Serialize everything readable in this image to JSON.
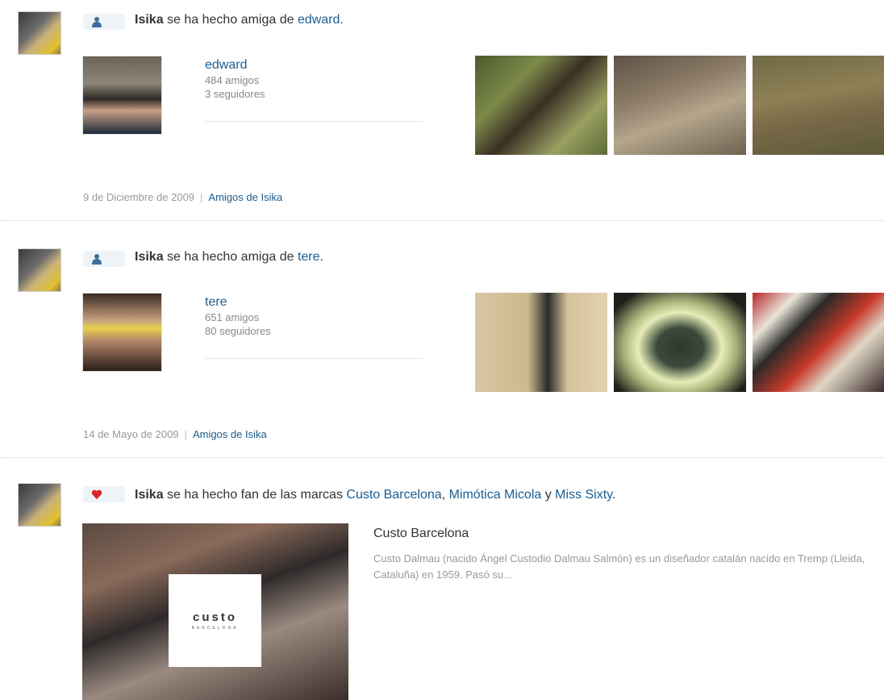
{
  "stories": [
    {
      "user": "Isika",
      "action": " se ha hecho amiga de ",
      "target": "edward",
      "end": ".",
      "friend": {
        "name": "edward",
        "friends": "484 amigos",
        "followers": "3 seguidores"
      },
      "date": "9 de Diciembre de 2009",
      "sep": "|",
      "link": "Amigos de Isika"
    },
    {
      "user": "Isika",
      "action": " se ha hecho amiga de ",
      "target": "tere",
      "end": ".",
      "friend": {
        "name": "tere",
        "friends": "651 amigos",
        "followers": "80 seguidores"
      },
      "date": "14 de Mayo de 2009",
      "sep": "|",
      "link": "Amigos de Isika"
    }
  ],
  "brand_story": {
    "user": "Isika",
    "action": " se ha hecho fan de las marcas ",
    "brands": [
      "Custo Barcelona",
      "Mimótica Micola",
      "Miss Sixty"
    ],
    "comma": ", ",
    "and": " y ",
    "end": ".",
    "featured": {
      "title": "Custo Barcelona",
      "description": "Custo Dalmau (nacido Ángel Custodio Dalmau Salmón) es un diseñador catalán nacido en Tremp (Lleida, Cataluña) en 1959. Pasó su...",
      "logo_text": "custo",
      "logo_sub": "BARCELONA"
    }
  },
  "icons": {
    "friend": "person-icon",
    "fan": "heart-icon"
  },
  "colors": {
    "link": "#1c5d8f",
    "heart": "#d9232d",
    "person_icon": "#3d6e9c",
    "icon_bg": "#eef3f8"
  }
}
